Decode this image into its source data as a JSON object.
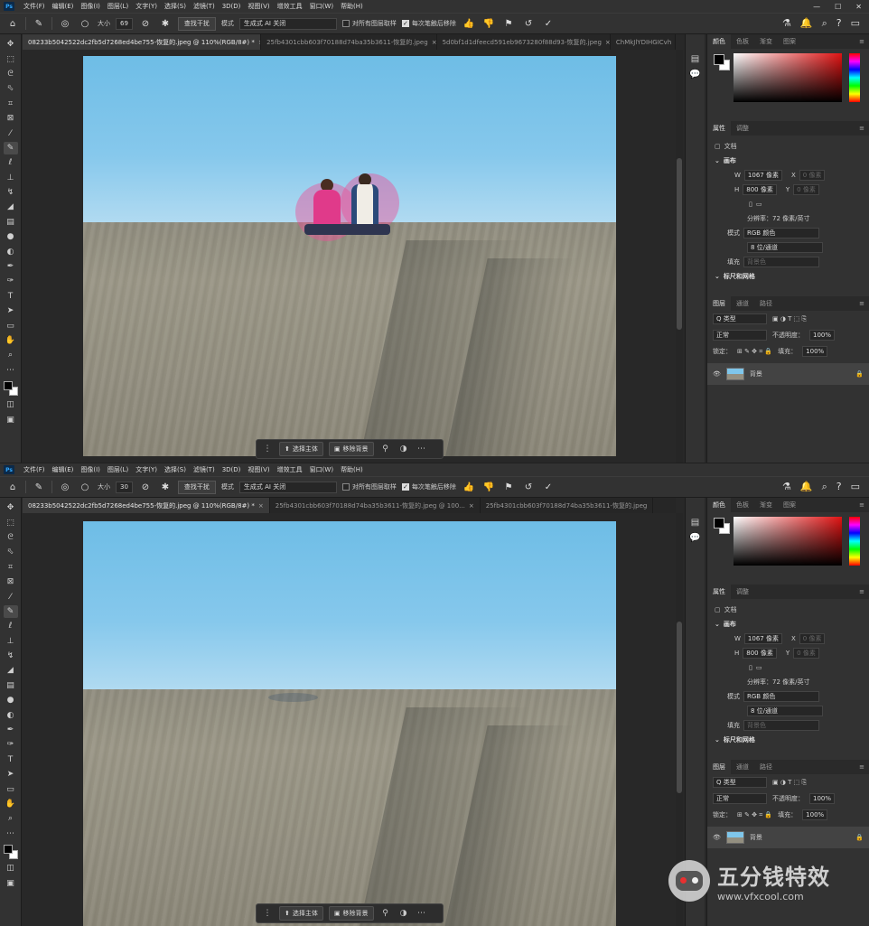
{
  "app": {
    "logo": "Ps"
  },
  "menu": [
    "文件(F)",
    "编辑(E)",
    "图像(I)",
    "图层(L)",
    "文字(Y)",
    "选择(S)",
    "滤镜(T)",
    "3D(D)",
    "视图(V)",
    "增效工具",
    "窗口(W)",
    "帮助(H)"
  ],
  "window_buttons": [
    "—",
    "☐",
    "✕"
  ],
  "options": {
    "size_label": "大小",
    "size_value_top": "69",
    "size_value_bottom": "30",
    "find_button": "查找干扰",
    "mode_label": "模式",
    "mode_value": "生成式 AI 关闭",
    "sample_all": "对所有图层取样",
    "remove_after": "每次笔触后移除"
  },
  "tabs_top": [
    {
      "label": "08233b5042522dc2fb5d7268ed4be755-恢复的.jpeg @ 110%(RGB/8#) *",
      "active": true
    },
    {
      "label": "25fb4301cbb603f70188d74ba35b3611-恢复的.jpeg",
      "active": false
    },
    {
      "label": "5d0bf1d1dfeecd591eb9673280f88d93-恢复的.jpeg",
      "active": false
    },
    {
      "label": "ChMkJlYDIHGICvh",
      "active": false
    }
  ],
  "tabs_bottom": [
    {
      "label": "08233b5042522dc2fb5d7268ed4be755-恢复的.jpeg @ 110%(RGB/8#) *",
      "active": true
    },
    {
      "label": "25fb4301cbb603f70188d74ba35b3611-恢复的.jpeg @ 100...",
      "active": false
    },
    {
      "label": "25fb4301cbb603f70188d74ba35b3611-恢复的.jpeg",
      "active": false
    }
  ],
  "floatbar": {
    "select_subject": "选择主体",
    "remove_bg": "移除背景"
  },
  "panels": {
    "color_tabs": [
      "颜色",
      "色板",
      "渐变",
      "图案"
    ],
    "prop_tabs": [
      "属性",
      "调整"
    ],
    "doc_label": "文档",
    "canvas_title": "画布",
    "w_label": "W",
    "w_value": "1067 像素",
    "h_label": "H",
    "h_value": "800 像素",
    "x_label": "X",
    "y_label": "Y",
    "xy_placeholder": "0 像素",
    "resolution": "分辨率：72 像素/英寸",
    "mode_label": "模式",
    "mode_value": "RGB 颜色",
    "depth_value": "8 位/通道",
    "fill_label": "填充",
    "fill_value": "背景色",
    "rulers_title": "标尺和网格",
    "layer_tabs": [
      "图层",
      "通道",
      "路径"
    ],
    "kind_label": "Q 类型",
    "blend_mode": "正常",
    "opacity_label": "不透明度：",
    "opacity_value": "100%",
    "lock_label": "锁定：",
    "fill2_label": "填充：",
    "fill2_value": "100%",
    "layer_name": "背景"
  },
  "watermark": {
    "cn": "五分钱特效",
    "url": "www.vfxcool.com"
  }
}
